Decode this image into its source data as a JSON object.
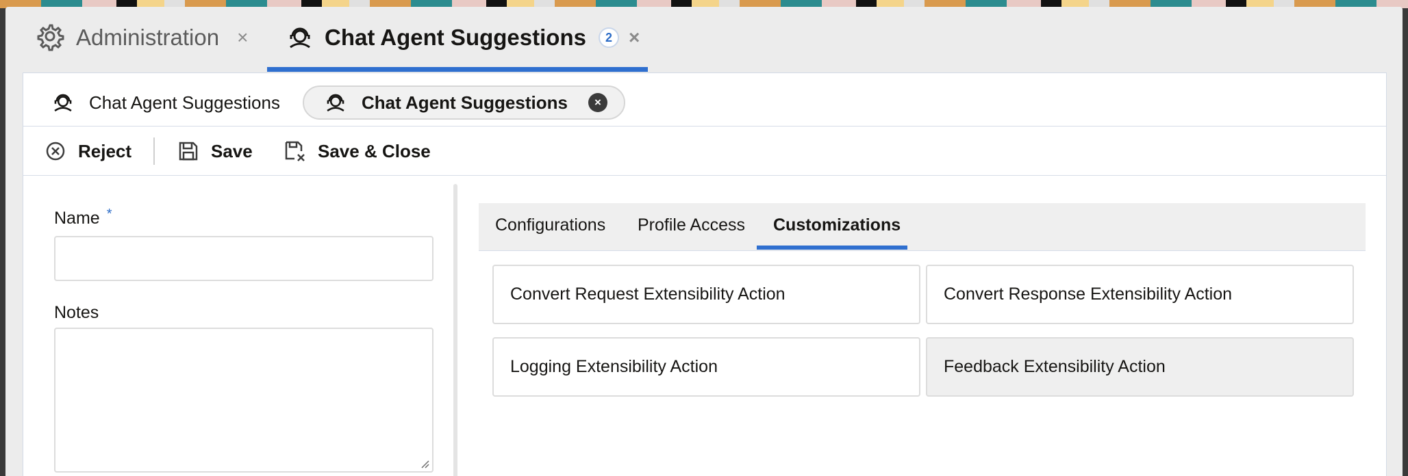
{
  "top_tabs": [
    {
      "label": "Administration",
      "close": "×"
    },
    {
      "label": "Chat Agent Suggestions",
      "badge": "2",
      "close": "×"
    }
  ],
  "sub_tabs": [
    {
      "label": "Chat Agent Suggestions"
    },
    {
      "label": "Chat Agent Suggestions",
      "close": "×"
    }
  ],
  "toolbar": {
    "reject_label": "Reject",
    "save_label": "Save",
    "save_close_label": "Save & Close"
  },
  "form": {
    "name_label": "Name",
    "required_marker": "*",
    "name_value": "",
    "notes_label": "Notes",
    "notes_value": ""
  },
  "detail_tabs": [
    {
      "label": "Configurations"
    },
    {
      "label": "Profile Access"
    },
    {
      "label": "Customizations",
      "active": true
    }
  ],
  "cards": [
    {
      "label": "Convert Request Extensibility Action"
    },
    {
      "label": "Convert Response Extensibility Action"
    },
    {
      "label": "Logging Extensibility Action"
    },
    {
      "label": "Feedback Extensibility Action"
    }
  ],
  "colors": {
    "accent": "#2f6fcf",
    "required": "#2c6cc7",
    "text": "#161513"
  }
}
